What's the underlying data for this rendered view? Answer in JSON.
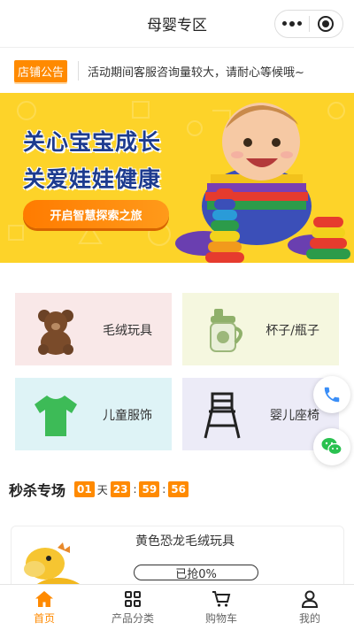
{
  "header": {
    "title": "母婴专区"
  },
  "notice": {
    "badge": "店铺公告",
    "text": "活动期间客服咨询量较大，请耐心等候哦~"
  },
  "banner": {
    "line1": "关心宝宝成长",
    "line2": "关爱娃娃健康",
    "cta": "开启智慧探索之旅"
  },
  "categories": [
    {
      "label": "毛绒玩具",
      "icon": "teddy-bear-icon",
      "bg": "#f9e8e8"
    },
    {
      "label": "杯子/瓶子",
      "icon": "sippy-cup-icon",
      "bg": "#f5f7df"
    },
    {
      "label": "儿童服饰",
      "icon": "tshirt-icon",
      "bg": "#def3f6"
    },
    {
      "label": "婴儿座椅",
      "icon": "high-chair-icon",
      "bg": "#ecebf7"
    }
  ],
  "flash_sale": {
    "title": "秒杀专场",
    "days": "01",
    "days_unit": "天",
    "hours": "23",
    "minutes": "59",
    "seconds": "56",
    "sep": ":"
  },
  "product": {
    "name": "黄色恐龙毛绒玩具",
    "sold_text": "已抢0%",
    "sold_fraction": 0
  },
  "tabs": [
    {
      "label": "首页",
      "icon": "home-icon",
      "active": true
    },
    {
      "label": "产品分类",
      "icon": "grid-icon",
      "active": false
    },
    {
      "label": "购物车",
      "icon": "cart-icon",
      "active": false
    },
    {
      "label": "我的",
      "icon": "user-icon",
      "active": false
    }
  ],
  "colors": {
    "accent": "#ff8a00",
    "banner_bg": "#fdd329",
    "banner_text": "#1d3b8f",
    "phone": "#3a8ef7",
    "wechat": "#2ac150"
  }
}
